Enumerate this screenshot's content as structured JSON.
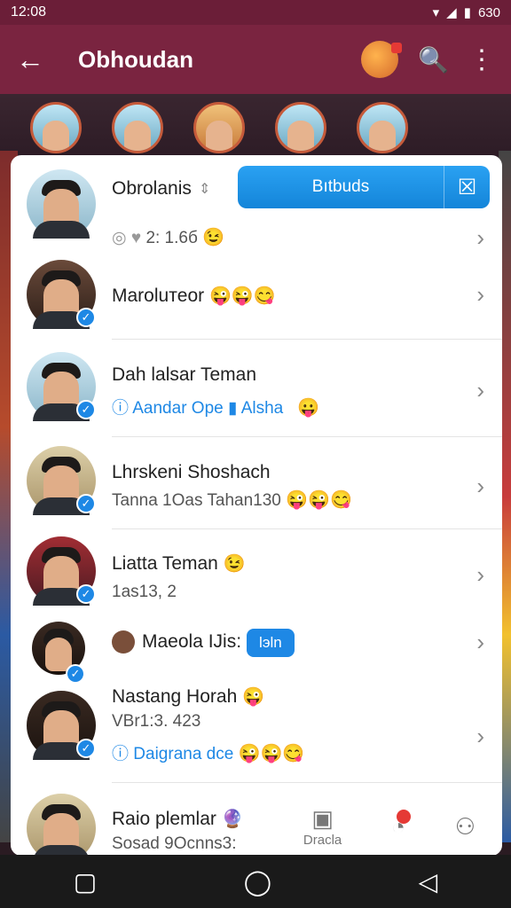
{
  "status_bar": {
    "time": "12:08",
    "right_text": "630"
  },
  "app_bar": {
    "title": "Obhoudan"
  },
  "panel": {
    "header": {
      "name": "Obrolanis",
      "stats": "2: 1.6б",
      "action_label": "Bıtbuds"
    },
    "rows": [
      {
        "name": "Maroluтeor",
        "emojis": "😜😜😋"
      },
      {
        "name": "Dah lalsar Teman",
        "sub": "Aandar Ope",
        "sub2": "Alsha",
        "emojis": "😛"
      },
      {
        "name": "Lhrskeni Shoshach",
        "sub": "Tanna 1Oas Tahan130",
        "emojis": "😜😜😋"
      },
      {
        "name": "Liatta Teman",
        "sub": "1as13, 2",
        "emojis": "😉"
      },
      {
        "name": "Maeola IJis:",
        "join": "lэln"
      },
      {
        "name": "Nastang Horah",
        "sub": "VBr1:3. 423",
        "sub2": "Daigrana dce",
        "emojis": "😜😜😋"
      },
      {
        "name": "Raio plemlar",
        "sub": "Sosad 9Ocnns3:"
      }
    ]
  },
  "bottom_nav": {
    "item_label": "Dracla"
  }
}
